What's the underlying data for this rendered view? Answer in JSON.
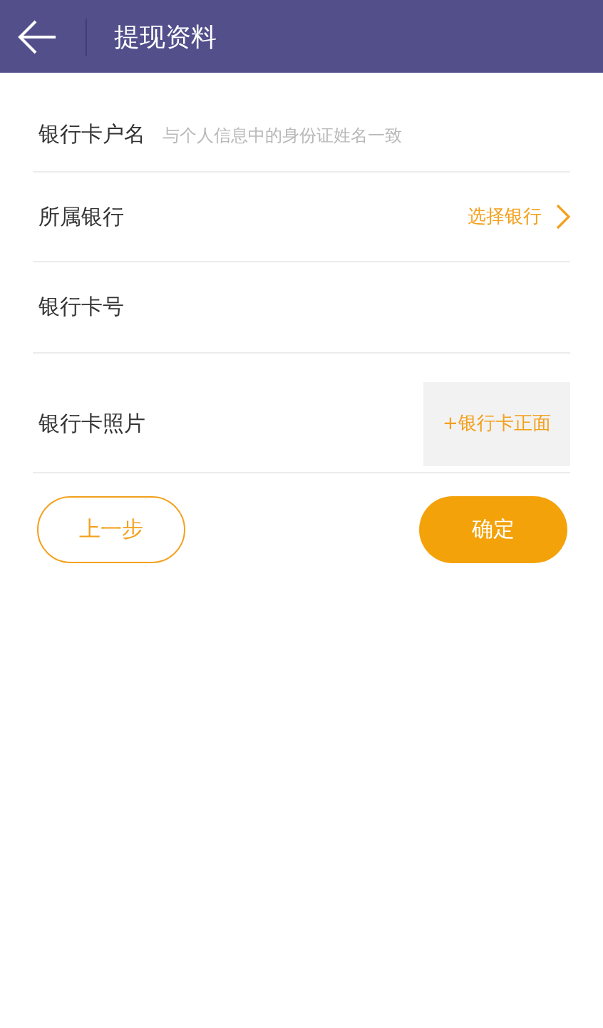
{
  "header": {
    "title": "提现资料"
  },
  "rows": [
    {
      "kind": "input",
      "label": "银行卡户名",
      "placeholder": "与个人信息中的身份证姓名一致"
    },
    {
      "kind": "select",
      "label": "所属银行",
      "action": "选择银行"
    },
    {
      "kind": "input",
      "label": "银行卡号"
    },
    {
      "kind": "photo",
      "label": "银行卡照片",
      "action": "+银行卡正面"
    }
  ],
  "buttons": [
    {
      "kind": "outline",
      "label": "上一步"
    },
    {
      "kind": "filled",
      "label": "确定"
    }
  ]
}
